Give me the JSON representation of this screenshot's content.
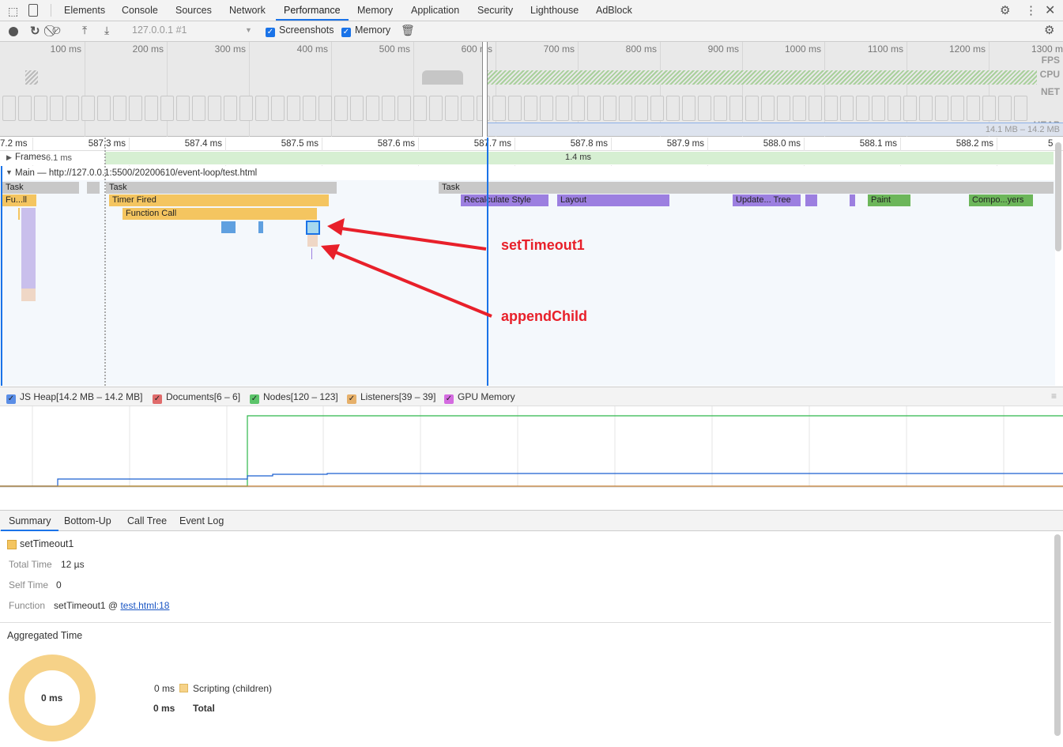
{
  "tabs": [
    "Elements",
    "Console",
    "Sources",
    "Network",
    "Performance",
    "Memory",
    "Application",
    "Security",
    "Lighthouse",
    "AdBlock"
  ],
  "toolbar": {
    "profile": "127.0.0.1 #1",
    "screenshots": "Screenshots",
    "memory": "Memory"
  },
  "overview": {
    "ticks": [
      "100 ms",
      "200 ms",
      "300 ms",
      "400 ms",
      "500 ms",
      "600 ms",
      "700 ms",
      "800 ms",
      "900 ms",
      "1000 ms",
      "1100 ms",
      "1200 ms",
      "1300 ms"
    ],
    "tracks": [
      "FPS",
      "CPU",
      "NET",
      "HEAP"
    ],
    "heap_range": "14.1 MB – 14.2 MB"
  },
  "ruler": [
    "7.2 ms",
    "587.3 ms",
    "587.4 ms",
    "587.5 ms",
    "587.6 ms",
    "587.7 ms",
    "587.8 ms",
    "587.9 ms",
    "588.0 ms",
    "588.1 ms",
    "588.2 ms",
    "5"
  ],
  "frames": {
    "label": "Frames",
    "left_value": "6.1 ms",
    "duration": "1.4 ms"
  },
  "main": {
    "label": "Main — http://127.0.0.1:5500/20200610/event-loop/test.html"
  },
  "events": {
    "task": "Task",
    "fu": "Fu...ll",
    "timer": "Timer Fired",
    "fcall": "Function Call",
    "recalc": "Recalculate Style",
    "layout": "Layout",
    "update": "Update... Tree",
    "paint": "Paint",
    "composite": "Compo...yers"
  },
  "annotations": {
    "a1": "setTimeout1",
    "a2": "appendChild"
  },
  "memory_legend": [
    "JS Heap[14.2 MB – 14.2 MB]",
    "Documents[6 – 6]",
    "Nodes[120 – 123]",
    "Listeners[39 – 39]",
    "GPU Memory"
  ],
  "memory_colors": [
    "#5b8ee6",
    "#e06b6b",
    "#5cc46a",
    "#e6b06a",
    "#d46be0"
  ],
  "bottom_tabs": [
    "Summary",
    "Bottom-Up",
    "Call Tree",
    "Event Log"
  ],
  "summary": {
    "title": "setTimeout1",
    "total_label": "Total Time",
    "total": "12 µs",
    "self_label": "Self Time",
    "self": "0",
    "func_label": "Function",
    "func": "setTimeout1 @ ",
    "link": "test.html:18",
    "agg": "Aggregated Time",
    "donut": "0 ms",
    "rows": [
      {
        "v": "0 ms",
        "l": "Scripting (children)"
      },
      {
        "v": "0 ms",
        "l": "Total"
      }
    ]
  }
}
